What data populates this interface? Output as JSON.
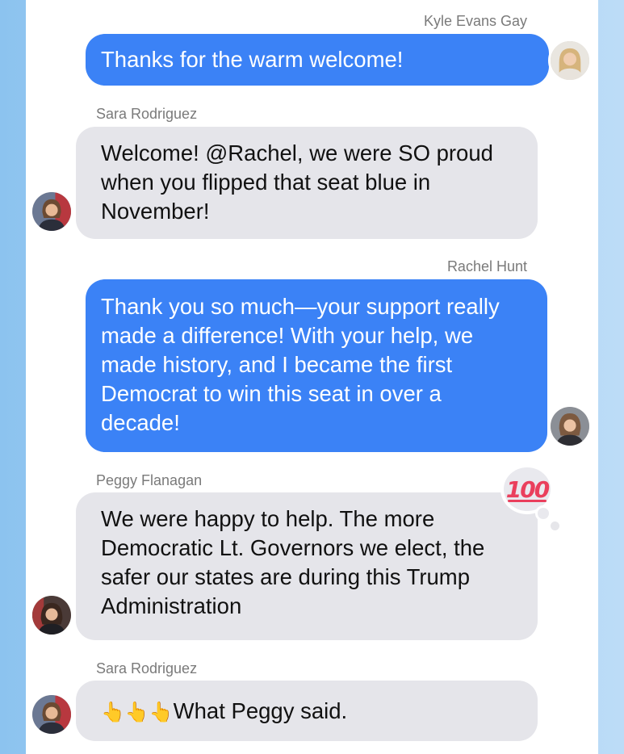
{
  "messages": [
    {
      "sender": "Kyle Evans Gay",
      "text": "Thanks for the warm welcome!"
    },
    {
      "sender": "Sara Rodriguez",
      "text": "Welcome! @Rachel, we were SO proud\nwhen you flipped that seat blue in\nNovember!"
    },
    {
      "sender": "Rachel Hunt",
      "text": "Thank you so much—your support really\nmade a difference! With your help, we\nmade history, and I became the first\nDemocrat to win this seat in over a\ndecade!"
    },
    {
      "sender": "Peggy Flanagan",
      "text": "We were happy to help. The more\nDemocratic Lt. Governors we elect, the\nsafer our states are during this Trump\nAdministration",
      "reaction": "💯"
    },
    {
      "sender": "Sara Rodriguez",
      "text": "What Peggy said.",
      "emoji_prefix": "👆👆👆"
    }
  ],
  "colors": {
    "outgoing_bubble": "#3b82f6",
    "incoming_bubble": "#e5e5ea",
    "sender_name": "#7a7a7a",
    "background": "#a7d2f5"
  },
  "icons": [
    "avatar-kyle-evans-gay",
    "avatar-sara-rodriguez",
    "avatar-rachel-hunt",
    "avatar-peggy-flanagan",
    "hundred-points-icon",
    "pointing-up-icon"
  ]
}
